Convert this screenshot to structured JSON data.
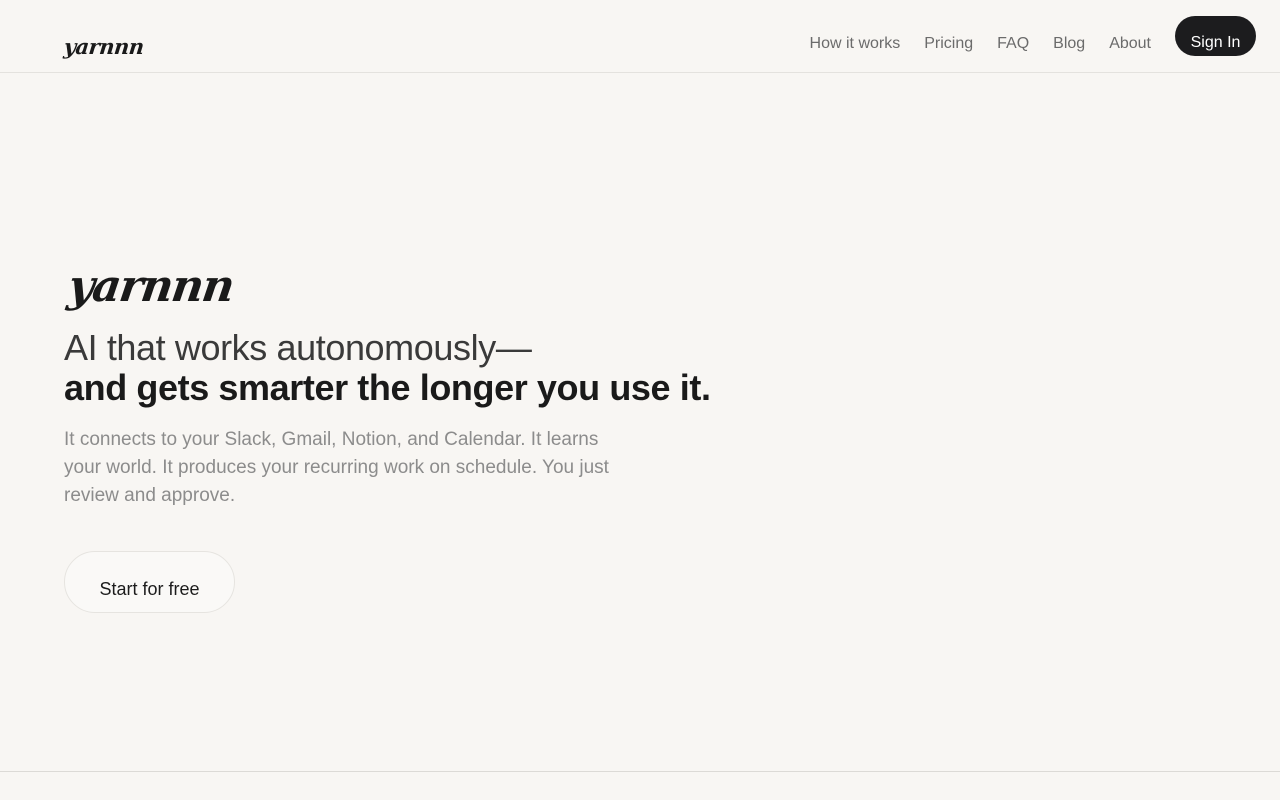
{
  "header": {
    "brand": "yarnnn",
    "nav": [
      "How it works",
      "Pricing",
      "FAQ",
      "Blog",
      "About"
    ],
    "signin_label": "Sign In"
  },
  "hero": {
    "brand": "yarnnn",
    "headline_line1": "AI that works autonomously—",
    "headline_line2": "and gets smarter the longer you use it.",
    "subtext": "It connects to your Slack, Gmail, Notion, and Calendar. It learns your world. It produces your recurring work on schedule. You just review and approve.",
    "cta_label": "Start for free"
  },
  "colors": {
    "background": "#f8f6f3",
    "primary_button": "#1c1c1e",
    "text": "#1c1c1c",
    "muted_text": "#8c8c8c"
  }
}
